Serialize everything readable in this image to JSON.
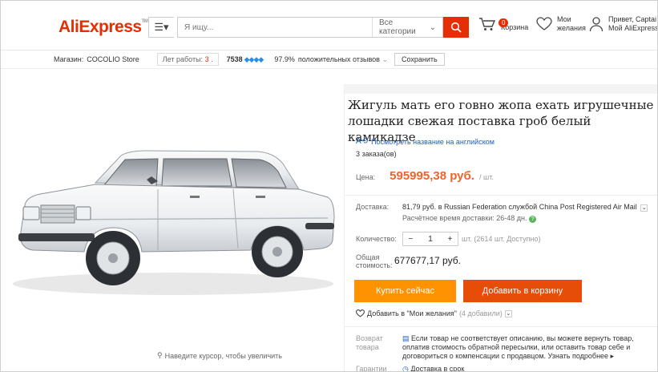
{
  "header": {
    "logo_main": "AliExpress",
    "logo_tm": "TM",
    "search_placeholder": "Я ищу...",
    "category_select": "Все категории",
    "cart_count": "0",
    "cart_label": "Корзина",
    "wishlist_line1": "Мои",
    "wishlist_line2": "желания",
    "user_line1": "Привет, Captai",
    "user_line2": "Мой AliExpress",
    "accent_color": "#e62e04"
  },
  "storebar": {
    "store_label": "Магазин:",
    "store_name": "COCOLIO Store",
    "years_label": "Лет работы:",
    "years_value": "3",
    "score": "7538",
    "diamonds": "💎💎💎💎",
    "positive_pct": "97.9%",
    "feedback_label": "положительных отзывов",
    "save_label": "Сохранить"
  },
  "gallery": {
    "hint": "Наведите курсор, чтобы увеличить"
  },
  "product": {
    "title": "Жигуль мать его говно жопа ехать игрушечные лошадки свежая поставка гроб белый камикадзе",
    "translate_link": "Посмотреть название на английском",
    "orders": "3 заказа(ов)",
    "price_label": "Цена:",
    "price_value": "595995,38 руб.",
    "price_unit": "/ шт.",
    "shipping_label": "Доставка:",
    "shipping_price": "81,79 руб.",
    "shipping_text": "в Russian Federation службой China Post Registered Air Mail",
    "delivery_time": "Расчётное время доставки: 26-48 дн.",
    "qty_label": "Количество:",
    "qty_minus": "−",
    "qty_value": "1",
    "qty_plus": "+",
    "qty_available": "шт. (2614 шт. Доступно)",
    "total_label_1": "Общая",
    "total_label_2": "стоимость:",
    "total_value": "677677,17 руб.",
    "buy_label": "Купить сейчас",
    "add_cart_label": "Добавить в корзину",
    "wish_label": "Добавить в \"Мои желания\"",
    "wish_count": "(4 добавили)",
    "returns_label_1": "Возврат",
    "returns_label_2": "товара",
    "returns_text": "Если товар не соответствует описанию, вы можете вернуть товар, оплатив стоимость обратной пересылки, или оставить товар себе и договориться о компенсации с продавцом.",
    "returns_more": "Узнать подробнее ▸",
    "guarantee_label": "Гарантии",
    "guarantee_text": "Доставка в срок",
    "price_color": "#f0642a",
    "buy_color": "#ff9200",
    "cart_color": "#e64d09"
  }
}
